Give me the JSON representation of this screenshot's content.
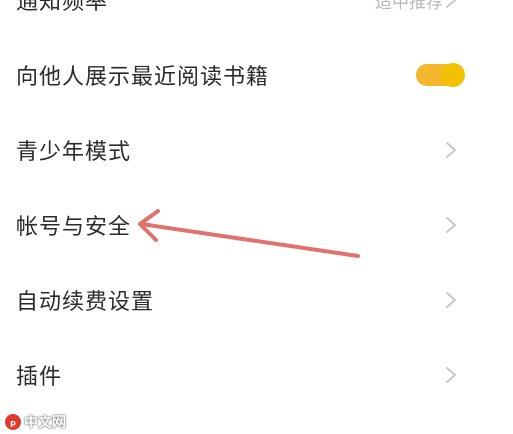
{
  "settings": {
    "items": [
      {
        "label": "通知频率",
        "value": "适中推荐",
        "control": "chevron"
      },
      {
        "label": "向他人展示最近阅读书籍",
        "control": "toggle",
        "toggle_on": true
      },
      {
        "label": "青少年模式",
        "control": "chevron"
      },
      {
        "label": "帐号与安全",
        "control": "chevron"
      },
      {
        "label": "自动续费设置",
        "control": "chevron"
      },
      {
        "label": "插件",
        "control": "chevron"
      }
    ]
  },
  "colors": {
    "text": "#2b2b2b",
    "secondary_text": "#b8b8b8",
    "chevron": "#c8c8c8",
    "toggle_track": "#f5b72e",
    "toggle_knob": "#f2c200",
    "annotation_arrow": "#e0716c",
    "watermark_logo": "#e03a2f"
  },
  "annotation": {
    "type": "arrow",
    "target": "帐号与安全",
    "icon": "red-arrow-annotation"
  },
  "watermark": {
    "text": "中文网",
    "logo_icon": "php-logo-icon"
  }
}
